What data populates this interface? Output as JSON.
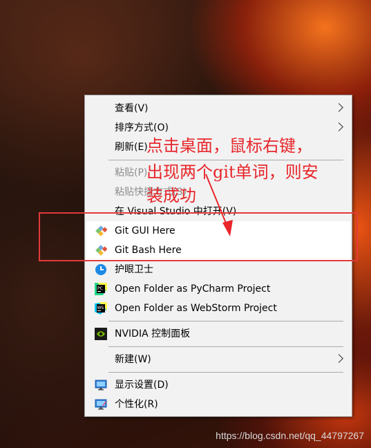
{
  "menu": {
    "items": [
      {
        "label": "查看(V)"
      },
      {
        "label": "排序方式(O)"
      },
      {
        "label": "刷新(E)"
      },
      {
        "label": "粘贴(P)"
      },
      {
        "label": "粘贴快捷方式(S)"
      },
      {
        "label": "在 Visual Studio 中打开(V)"
      },
      {
        "label": "Git GUI Here"
      },
      {
        "label": "Git Bash Here"
      },
      {
        "label": "护眼卫士"
      },
      {
        "label": "Open Folder as PyCharm Project"
      },
      {
        "label": "Open Folder as WebStorm Project"
      },
      {
        "label": "NVIDIA 控制面板"
      },
      {
        "label": "新建(W)"
      },
      {
        "label": "显示设置(D)"
      },
      {
        "label": "个性化(R)"
      }
    ]
  },
  "annotation": {
    "line1": "点击桌面，鼠标右键，",
    "line2": "出现两个git单词，则安",
    "line3": "装成功",
    "color": "#e8262b"
  },
  "icons": {
    "git": "git-diamond-icon",
    "eye_guard": "eye-guard-icon",
    "pycharm": "pycharm-icon",
    "webstorm": "webstorm-icon",
    "nvidia": "nvidia-icon",
    "display": "display-settings-icon",
    "personalize": "personalize-icon"
  },
  "watermark": "https://blog.csdn.net/qq_44797267"
}
